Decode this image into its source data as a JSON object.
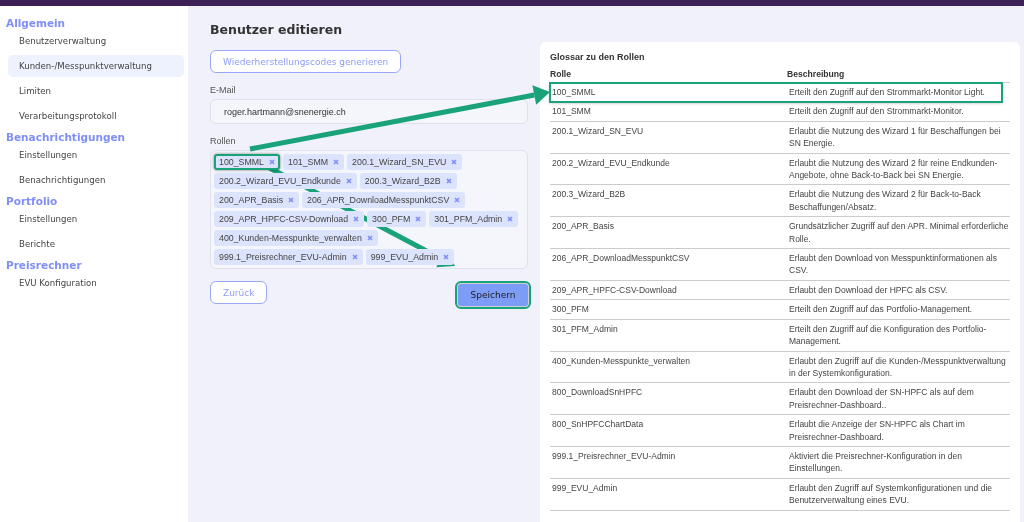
{
  "sidebar": {
    "sections": [
      {
        "heading": "Allgemein",
        "items": [
          {
            "label": "Benutzerverwaltung",
            "selected": false
          },
          {
            "label": "Kunden-/Messpunktverwaltung",
            "selected": true
          },
          {
            "label": "Limiten",
            "selected": false
          },
          {
            "label": "Verarbeitungsprotokoll",
            "selected": false
          }
        ]
      },
      {
        "heading": "Benachrichtigungen",
        "items": [
          {
            "label": "Einstellungen",
            "selected": false
          },
          {
            "label": "Benachrichtigungen",
            "selected": false
          }
        ]
      },
      {
        "heading": "Portfolio",
        "items": [
          {
            "label": "Einstellungen",
            "selected": false
          },
          {
            "label": "Berichte",
            "selected": false
          }
        ]
      },
      {
        "heading": "Preisrechner",
        "items": [
          {
            "label": "EVU Konfiguration",
            "selected": false
          }
        ]
      }
    ]
  },
  "form": {
    "title": "Benutzer editieren",
    "recovery_button": "Wiederherstellungscodes generieren",
    "email": {
      "label": "E-Mail",
      "value": "roger.hartmann@snenergie.ch"
    },
    "roles": {
      "label": "Rollen",
      "tags": [
        {
          "label": "100_SMML",
          "highlighted": true
        },
        {
          "label": "101_SMM",
          "highlighted": false
        },
        {
          "label": "200.1_Wizard_SN_EVU",
          "highlighted": false
        },
        {
          "label": "200.2_Wizard_EVU_Endkunde",
          "highlighted": false
        },
        {
          "label": "200.3_Wizard_B2B",
          "highlighted": false
        },
        {
          "label": "200_APR_Basis",
          "highlighted": false
        },
        {
          "label": "206_APR_DownloadMesspunktCSV",
          "highlighted": false
        },
        {
          "label": "209_APR_HPFC-CSV-Download",
          "highlighted": false
        },
        {
          "label": "300_PFM",
          "highlighted": false
        },
        {
          "label": "301_PFM_Admin",
          "highlighted": false
        },
        {
          "label": "400_Kunden-Messpunkte_verwalten",
          "highlighted": false
        },
        {
          "label": "999.1_Preisrechner_EVU-Admin",
          "highlighted": false
        },
        {
          "label": "999_EVU_Admin",
          "highlighted": false
        }
      ]
    },
    "back_button": {
      "label": "Zurück",
      "highlighted": false
    },
    "save_button": {
      "label": "Speichern",
      "highlighted": true
    }
  },
  "glossary": {
    "title": "Glossar zu den Rollen",
    "columns": [
      "Rolle",
      "Beschreibung"
    ],
    "rows": [
      {
        "role": "100_SMML",
        "description": "Erteilt den Zugriff auf den Strommarkt-Monitor Light.",
        "highlighted": true
      },
      {
        "role": "101_SMM",
        "description": "Erteilt den Zugriff auf den Strommarkt-Monitor.",
        "highlighted": false
      },
      {
        "role": "200.1_Wizard_SN_EVU",
        "description": "Erlaubt die Nutzung des Wizard 1 für Beschaffungen bei SN Energie.",
        "highlighted": false
      },
      {
        "role": "200.2_Wizard_EVU_Endkunde",
        "description": "Erlaubt die Nutzung des Wizard 2 für reine Endkunden-Angebote, ohne Back-to-Back bei SN Energie.",
        "highlighted": false
      },
      {
        "role": "200.3_Wizard_B2B",
        "description": "Erlaubt die Nutzung des Wizard 2 für Back-to-Back Beschaffungen/Absatz.",
        "highlighted": false
      },
      {
        "role": "200_APR_Basis",
        "description": "Grundsätzlicher Zugriff auf den APR. Minimal erforderliche Rolle.",
        "highlighted": false
      },
      {
        "role": "206_APR_DownloadMesspunktCSV",
        "description": "Erlaubt den Download von Messpunktinformationen als CSV.",
        "highlighted": false
      },
      {
        "role": "209_APR_HPFC-CSV-Download",
        "description": "Erlaubt den Download der HPFC als CSV.",
        "highlighted": false
      },
      {
        "role": "300_PFM",
        "description": "Erteilt den Zugriff auf das Portfolio-Management.",
        "highlighted": false
      },
      {
        "role": "301_PFM_Admin",
        "description": "Erteilt den Zugriff auf die Konfiguration des Portfolio-Management.",
        "highlighted": false
      },
      {
        "role": "400_Kunden-Messpunkte_verwalten",
        "description": "Erlaubt den Zugriff auf die Kunden-/Messpunktverwaltung in der Systemkonfiguration.",
        "highlighted": false
      },
      {
        "role": "800_DownloadSnHPFC",
        "description": "Erlaubt den Download der SN-HPFC als auf dem Preisrechner-Dashboard..",
        "highlighted": false
      },
      {
        "role": "800_SnHPFCChartData",
        "description": "Erlaubt die Anzeige der SN-HPFC als Chart im Preisrechner-Dashboard.",
        "highlighted": false
      },
      {
        "role": "999.1_Preisrechner_EVU-Admin",
        "description": "Aktiviert die Preisrechner-Konfiguration in den Einstellungen.",
        "highlighted": false
      },
      {
        "role": "999_EVU_Admin",
        "description": "Erlaubt den Zugriff auf Systemkonfigurationen und die Benutzerverwaltung eines EVU.",
        "highlighted": false
      }
    ]
  }
}
